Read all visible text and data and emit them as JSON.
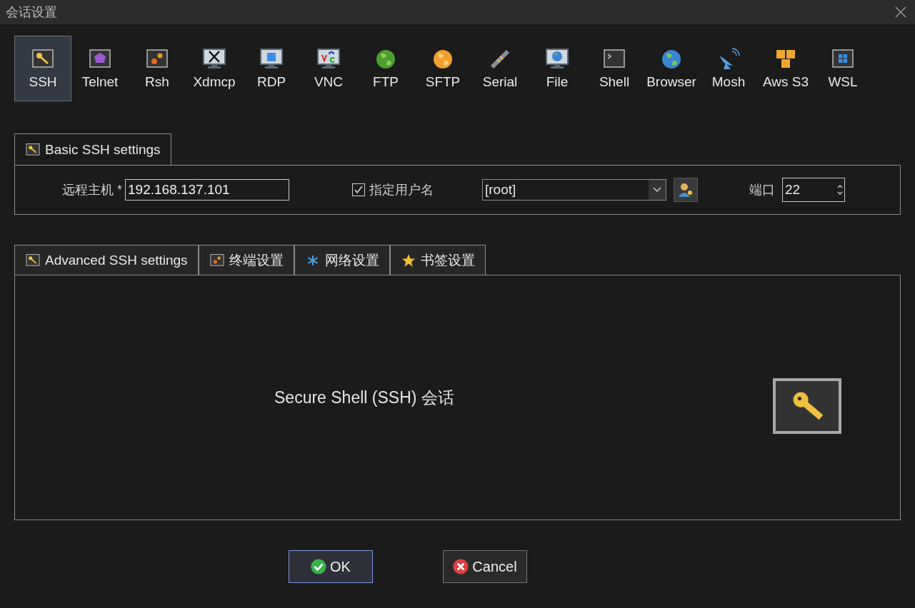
{
  "window": {
    "title": "会话设置"
  },
  "session_types": [
    {
      "label": "SSH",
      "kind": "key",
      "selected": true
    },
    {
      "label": "Telnet",
      "kind": "gem",
      "selected": false
    },
    {
      "label": "Rsh",
      "kind": "gears",
      "selected": false
    },
    {
      "label": "Xdmcp",
      "kind": "xmonitor",
      "selected": false
    },
    {
      "label": "RDP",
      "kind": "winmonitor",
      "selected": false
    },
    {
      "label": "VNC",
      "kind": "vncmonitor",
      "selected": false
    },
    {
      "label": "FTP",
      "kind": "greenglobe",
      "selected": false
    },
    {
      "label": "SFTP",
      "kind": "orangeglobe",
      "selected": false
    },
    {
      "label": "Serial",
      "kind": "plug",
      "selected": false
    },
    {
      "label": "File",
      "kind": "globemonitor",
      "selected": false
    },
    {
      "label": "Shell",
      "kind": "terminal",
      "selected": false
    },
    {
      "label": "Browser",
      "kind": "blueglobe",
      "selected": false
    },
    {
      "label": "Mosh",
      "kind": "dish",
      "selected": false
    },
    {
      "label": "Aws S3",
      "kind": "cubes",
      "selected": false
    },
    {
      "label": "WSL",
      "kind": "winbox",
      "selected": false
    }
  ],
  "basic_settings": {
    "tab": "Basic SSH settings",
    "host_label": "远程主机 *",
    "host_value": "192.168.137.101",
    "username_checkbox": {
      "label": "指定用户名",
      "checked": true
    },
    "username_value": "[root]",
    "port_label": "端口",
    "port_value": "22"
  },
  "advanced_tabs": [
    {
      "label": "Advanced SSH settings",
      "kind": "key"
    },
    {
      "label": "终端设置",
      "kind": "gears"
    },
    {
      "label": "网络设置",
      "kind": "network"
    },
    {
      "label": "书签设置",
      "kind": "star"
    }
  ],
  "panel": {
    "description": "Secure Shell (SSH) 会话"
  },
  "buttons": [
    {
      "label": "OK",
      "kind": "ok"
    },
    {
      "label": "Cancel",
      "kind": "cancel"
    }
  ]
}
